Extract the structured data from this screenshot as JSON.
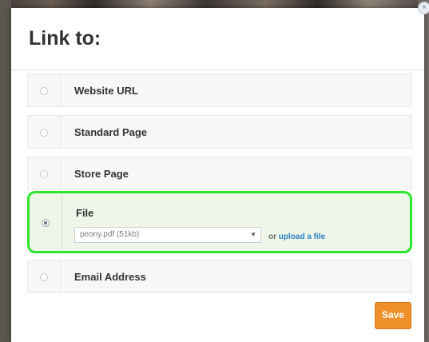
{
  "dialog": {
    "title": "Link to:",
    "close_glyph": "×"
  },
  "options": [
    {
      "label": "Website URL",
      "selected": false
    },
    {
      "label": "Standard Page",
      "selected": false
    },
    {
      "label": "Store Page",
      "selected": false
    },
    {
      "label": "File",
      "selected": true
    },
    {
      "label": "Email Address",
      "selected": false
    }
  ],
  "file": {
    "selected_value": "peony.pdf (51kb)",
    "or_text": "or",
    "upload_link": "upload a file"
  },
  "actions": {
    "save_label": "Save"
  },
  "colors": {
    "highlight_border": "#2ee52e",
    "highlight_fill": "#edf6e8",
    "save_button": "#f0902a",
    "link": "#2a7fc0"
  },
  "icons": {
    "dropdown": "chevron-down-icon",
    "close": "close-icon"
  }
}
